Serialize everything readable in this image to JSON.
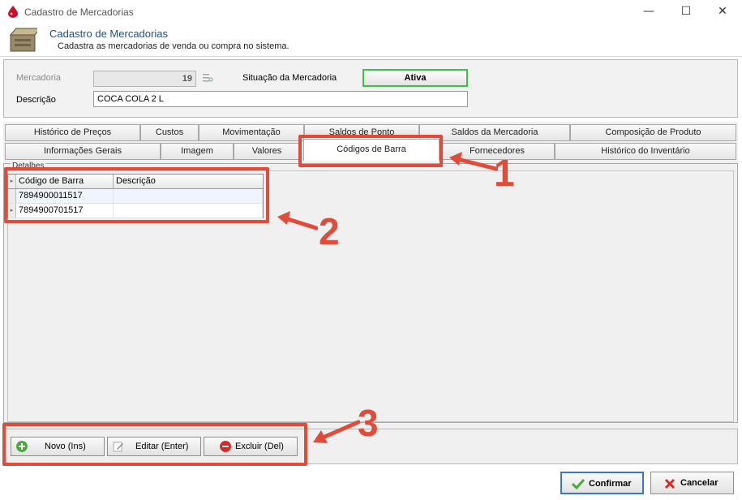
{
  "window": {
    "title": "Cadastro de Mercadorias",
    "minimize": "—",
    "maximize": "☐",
    "close": "✕"
  },
  "header": {
    "title": "Cadastro de Mercadorias",
    "subtitle": "Cadastra as mercadorias de venda ou compra no sistema."
  },
  "form": {
    "mercadoria_label": "Mercadoria",
    "mercadoria_value": "19",
    "situacao_label": "Situação da Mercadoria",
    "situacao_value": "Ativa",
    "descricao_label": "Descrição",
    "descricao_value": "COCA COLA 2 L"
  },
  "tabs_row1": [
    "Histórico de Preços",
    "Custos",
    "Movimentação",
    "Saldos de Ponto",
    "Saldos da Mercadoria",
    "Composição de Produto"
  ],
  "tabs_row2": [
    "Informações Gerais",
    "Imagem",
    "Valores",
    "Códigos de Barra",
    "Fornecedores",
    "Histórico do Inventário"
  ],
  "panel_caption": "Detalhes",
  "grid": {
    "columns": [
      "Código de Barra",
      "Descrição"
    ],
    "rows": [
      {
        "codigo": "7894900011517",
        "descricao": ""
      },
      {
        "codigo": "7894900701517",
        "descricao": ""
      }
    ]
  },
  "buttons": {
    "novo": "Novo (Ins)",
    "editar": "Editar (Enter)",
    "excluir": "Excluir (Del)"
  },
  "footer": {
    "confirmar": "Confirmar",
    "cancelar": "Cancelar"
  },
  "annotations": {
    "one": "1",
    "two": "2",
    "three": "3",
    "color": "#e04b3a"
  },
  "colors": {
    "accent_green": "#3cc24a",
    "title_blue": "#1f4e8c",
    "primary_border": "#3b77c9"
  },
  "icons": [
    "app-drop-icon",
    "box-icon",
    "list-settings-icon",
    "plus-green-icon",
    "edit-icon",
    "minus-red-icon",
    "check-icon",
    "x-icon"
  ]
}
